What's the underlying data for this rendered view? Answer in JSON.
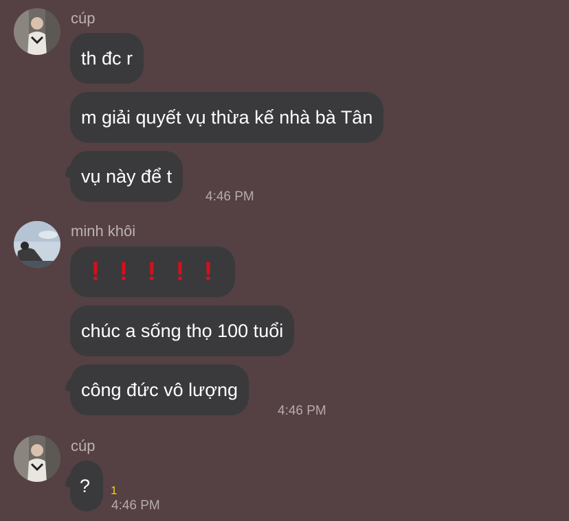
{
  "groups": [
    {
      "sender": "cúp",
      "avatar_icon": "person-photo-avatar",
      "messages": [
        "th đc r",
        "m giải quyết vụ thừa kế nhà bà Tân",
        "vụ này để t"
      ],
      "time": "4:46 PM"
    },
    {
      "sender": "minh khôi",
      "avatar_icon": "person-sky-photo-avatar",
      "messages": [
        "❗❗❗❗❗",
        "chúc a sống thọ 100 tuổi",
        "công đức vô lượng"
      ],
      "time": "4:46 PM"
    },
    {
      "sender": "cúp",
      "avatar_icon": "person-photo-avatar",
      "messages": [
        "?"
      ],
      "read_count": "1",
      "time": "4:46 PM"
    }
  ],
  "colors": {
    "background": "#554043",
    "bubble": "#3a3a3c",
    "exclamation": "#d70f1c",
    "read_count": "#f5d400"
  }
}
